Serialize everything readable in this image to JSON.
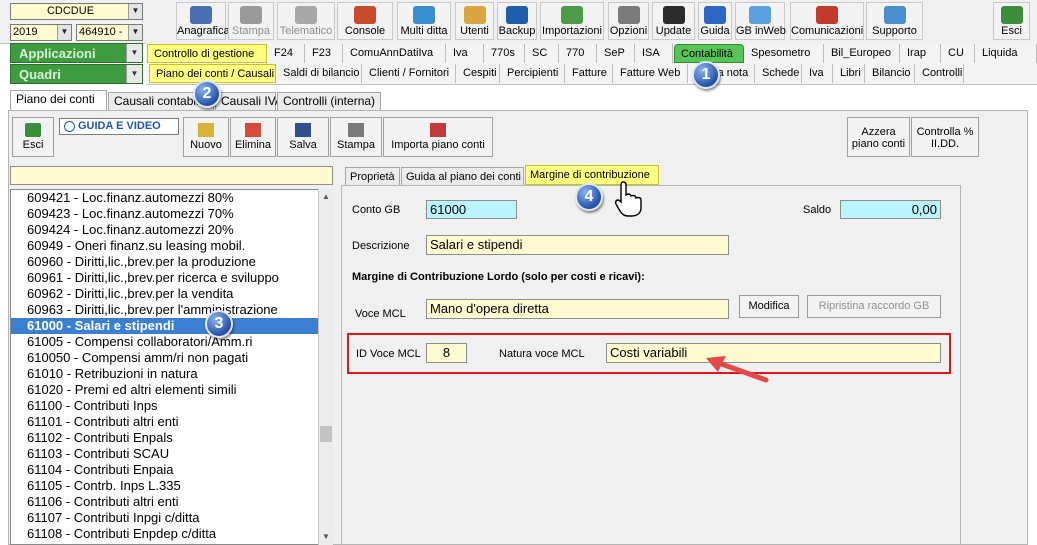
{
  "header": {
    "company": "CDCDUE",
    "year": "2019",
    "code": "464910 -"
  },
  "toolbar": [
    {
      "label": "Anagrafica",
      "icon": "address-book-icon",
      "color": "#4a6fb3"
    },
    {
      "label": "Stampa",
      "icon": "printer-icon",
      "color": "#9a9a9a",
      "disabled": true
    },
    {
      "label": "Telematico",
      "icon": "telematico-icon",
      "color": "#a8a8a8",
      "disabled": true
    },
    {
      "label": "Console",
      "icon": "console-icon",
      "color": "#c94b2b"
    },
    {
      "label": "Multi ditta",
      "icon": "multi-company-icon",
      "color": "#3a8dd1"
    },
    {
      "label": "Utenti",
      "icon": "users-icon",
      "color": "#d9a640"
    },
    {
      "label": "Backup",
      "icon": "backup-icon",
      "color": "#1f5ea8"
    },
    {
      "label": "Importazioni",
      "icon": "import-icon",
      "color": "#4c9c4c"
    },
    {
      "label": "Opzioni",
      "icon": "wrench-icon",
      "color": "#7a7a7a"
    },
    {
      "label": "Update",
      "icon": "update-icon",
      "color": "#2b2b2b"
    },
    {
      "label": "Guida",
      "icon": "help-icon",
      "color": "#2d67c3"
    },
    {
      "label": "GB inWeb",
      "icon": "cloud-icon",
      "color": "#5aa0e0"
    },
    {
      "label": "Comunicazioni",
      "icon": "communications-icon",
      "color": "#c43a2a"
    },
    {
      "label": "Supporto",
      "icon": "support-icon",
      "color": "#4c8fd0"
    },
    {
      "label": "Esci",
      "icon": "exit-icon",
      "color": "#3b8f3b"
    }
  ],
  "ribbon": {
    "applicazioni_label": "Applicazioni",
    "quadri_label": "Quadri",
    "row1": [
      "Controllo di gestione",
      "F24",
      "F23",
      "ComuAnnDatiIva",
      "Iva",
      "770s",
      "SC",
      "770",
      "SeP",
      "ISA",
      "Contabilità",
      "Spesometro",
      "Bil_Europeo",
      "Irap",
      "CU",
      "Liquida"
    ],
    "row2": [
      "Piano dei conti / Causali",
      "Saldi di bilancio",
      "Clienti / Fornitori",
      "Cespiti",
      "Percipienti",
      "Fatture",
      "Fatture Web",
      "Prima nota",
      "Schede",
      "Iva",
      "Libri",
      "Bilancio",
      "Controlli"
    ]
  },
  "main_tabs": [
    "Piano dei conti",
    "Causali contabili",
    "Causali IVA",
    "Controlli (interna)"
  ],
  "actions": {
    "esci": "Esci",
    "guida_video": "GUIDA E VIDEO",
    "nuovo": "Nuovo",
    "elimina": "Elimina",
    "salva": "Salva",
    "stampa": "Stampa",
    "importa": "Importa piano conti",
    "azzera_1": "Azzera",
    "azzera_2": "piano conti",
    "controlla_1": "Controlla %",
    "controlla_2": "II.DD."
  },
  "search_value": "",
  "accounts": [
    "609421 - Loc.finanz.automezzi 80%",
    "609423 - Loc.finanz.automezzi 70%",
    "609424 - Loc.finanz.automezzi 20%",
    "60949 - Oneri finanz.su leasing mobil.",
    "60960 - Diritti,lic.,brev.per la produzione",
    "60961 - Diritti,lic.,brev.per ricerca e sviluppo",
    "60962 - Diritti,lic.,brev.per la vendita",
    "60963 - Diritti,lic.,brev.per l'amministrazione",
    "61000 - Salari e stipendi",
    "61005 - Compensi collaboratori/Amm.ri",
    "610050 - Compensi amm/ri non pagati",
    "61010 - Retribuzioni in natura",
    "61020 - Premi ed altri elementi simili",
    "61100 - Contributi Inps",
    "61101 - Contributi altri enti",
    "61102 - Contributi Enpals",
    "61103 - Contributi SCAU",
    "61104 - Contributi Enpaia",
    "61105 - Contrb. Inps L.335",
    "61106 - Contributi altri enti",
    "61107 - Contributi Inpgi c/ditta",
    "61108 - Contributi Enpdep c/ditta"
  ],
  "selected_index": 8,
  "detail_tabs": [
    "Proprietà",
    "Guida al piano dei conti",
    "Margine di contribuzione"
  ],
  "form": {
    "conto_gb_label": "Conto GB",
    "conto_gb_value": "61000",
    "saldo_label": "Saldo",
    "saldo_value": "0,00",
    "descrizione_label": "Descrizione",
    "descrizione_value": "Salari e stipendi",
    "section_title": "Margine di Contribuzione Lordo (solo per costi e ricavi):",
    "voce_mcl_label": "Voce MCL",
    "voce_mcl_value": "Mano d'opera diretta",
    "modifica_label": "Modifica",
    "ripristina_label": "Ripristina raccordo GB",
    "id_voce_label": "ID Voce MCL",
    "id_voce_value": "8",
    "natura_label": "Natura voce MCL",
    "natura_value": "Costi variabili"
  },
  "callouts": [
    "1",
    "2",
    "3",
    "4"
  ],
  "colors": {
    "highlight_red": "#e0161b",
    "arrow_red": "#e24a4a",
    "selection_blue": "#3a7fd1",
    "field_yellow": "#fffbd0",
    "field_cyan": "#b9f4ff",
    "green_header": "#3f9b3f"
  }
}
